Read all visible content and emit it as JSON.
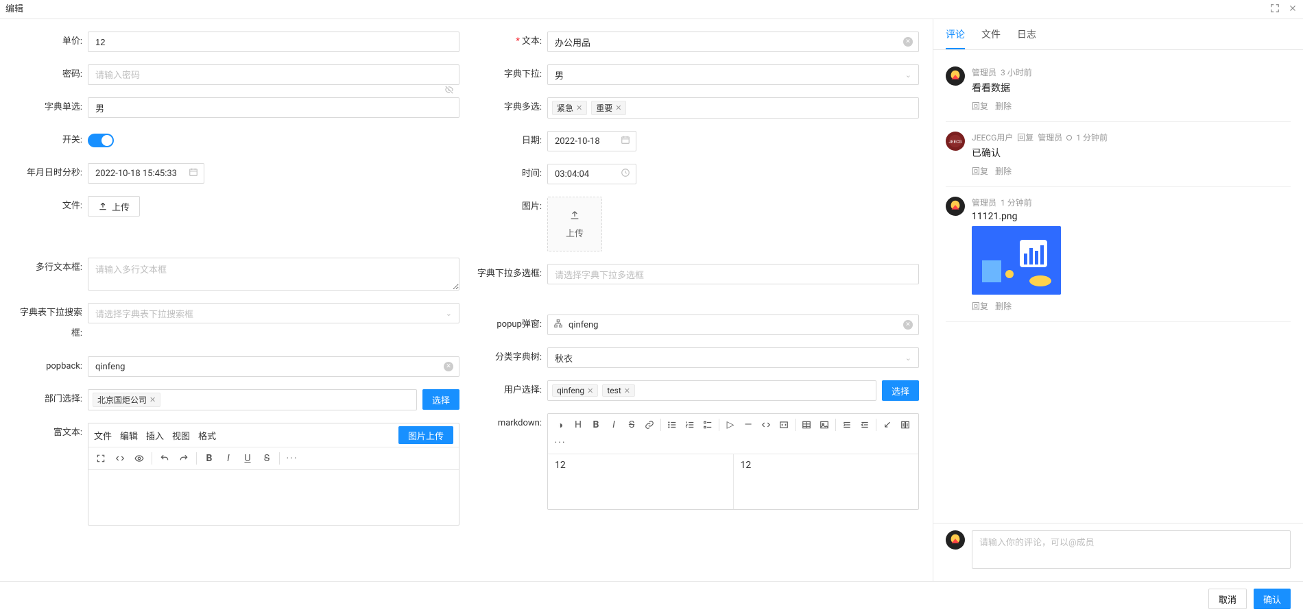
{
  "dialog": {
    "title": "编辑",
    "cancel": "取消",
    "ok": "确认"
  },
  "labels": {
    "unit_price": "单价:",
    "text": "文本:",
    "password": "密码:",
    "dict_dropdown": "字典下拉:",
    "dict_radio": "字典单选:",
    "dict_multi": "字典多选:",
    "switch": "开关:",
    "date": "日期:",
    "datetime": "年月日时分秒:",
    "time": "时间:",
    "file": "文件:",
    "image": "图片:",
    "textarea": "多行文本框:",
    "dict_multi_dropdown": "字典下拉多选框:",
    "dict_search_dropdown": "字典表下拉搜索框:",
    "popup": "popup弹窗:",
    "popback": "popback:",
    "category_tree": "分类字典树:",
    "dept_select": "部门选择:",
    "user_select": "用户选择:",
    "richtext": "富文本:",
    "markdown": "markdown:"
  },
  "values": {
    "unit_price": "12",
    "text": "办公用品",
    "password_placeholder": "请输入密码",
    "dict_dropdown": "男",
    "dict_radio": "男",
    "dict_multi": [
      "紧急",
      "重要"
    ],
    "date": "2022-10-18",
    "datetime": "2022-10-18 15:45:33",
    "time": "03:04:04",
    "upload_btn": "上传",
    "upload_box": "上传",
    "textarea_placeholder": "请输入多行文本框",
    "dict_multi_dropdown_placeholder": "请选择字典下拉多选框",
    "dict_search_dropdown_placeholder": "请选择字典表下拉搜索框",
    "popup": "qinfeng",
    "popback": "qinfeng",
    "category_tree": "秋衣",
    "dept_select": [
      "北京国炬公司"
    ],
    "user_select": [
      "qinfeng",
      "test"
    ],
    "select_btn": "选择",
    "md_left": "12",
    "md_right": "12"
  },
  "richtext": {
    "menus": [
      "文件",
      "编辑",
      "插入",
      "视图",
      "格式"
    ],
    "upload_btn": "图片上传"
  },
  "sidebar": {
    "tabs": [
      "评论",
      "文件",
      "日志"
    ],
    "active_tab": 0,
    "comment_placeholder": "请输入你的评论，可以@成员",
    "reply": "回复",
    "delete": "删除",
    "comments": [
      {
        "author": "管理员",
        "time": "3 小时前",
        "text": "看看数据"
      },
      {
        "author": "JEECG用户",
        "reply_label": "回复",
        "reply_to": "管理员",
        "time": "1 分钟前",
        "text": "已确认"
      },
      {
        "author": "管理员",
        "time": "1 分钟前",
        "text": "11121.png",
        "has_image": true
      }
    ]
  }
}
